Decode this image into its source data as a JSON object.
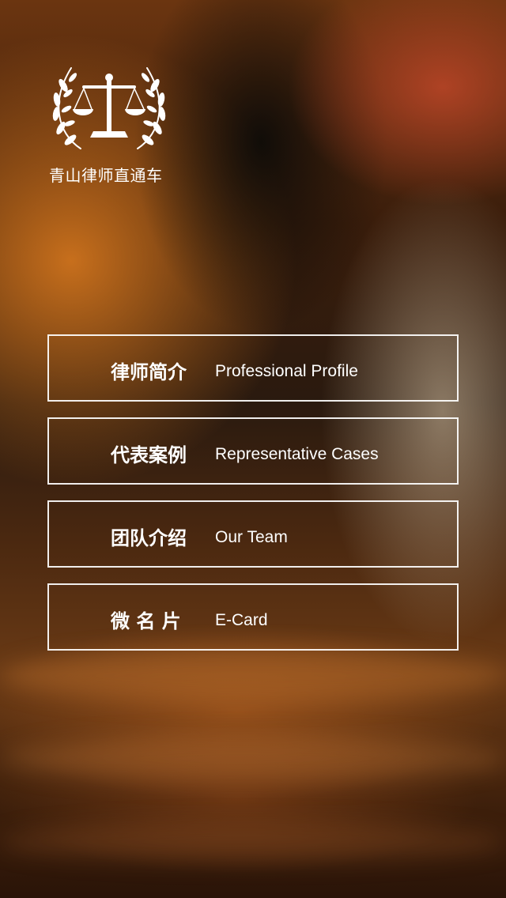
{
  "brand": {
    "logo_icon": "scales-of-justice-laurel-icon",
    "name": "青山律师直通车"
  },
  "menu": [
    {
      "cn": "律师简介",
      "en": "Professional Profile"
    },
    {
      "cn": "代表案例",
      "en": "Representative Cases"
    },
    {
      "cn": "团队介绍",
      "en": "Our Team"
    },
    {
      "cn": "微 名 片",
      "en": "E-Card"
    }
  ],
  "colors": {
    "text": "#ffffff",
    "border": "#ffffff"
  }
}
